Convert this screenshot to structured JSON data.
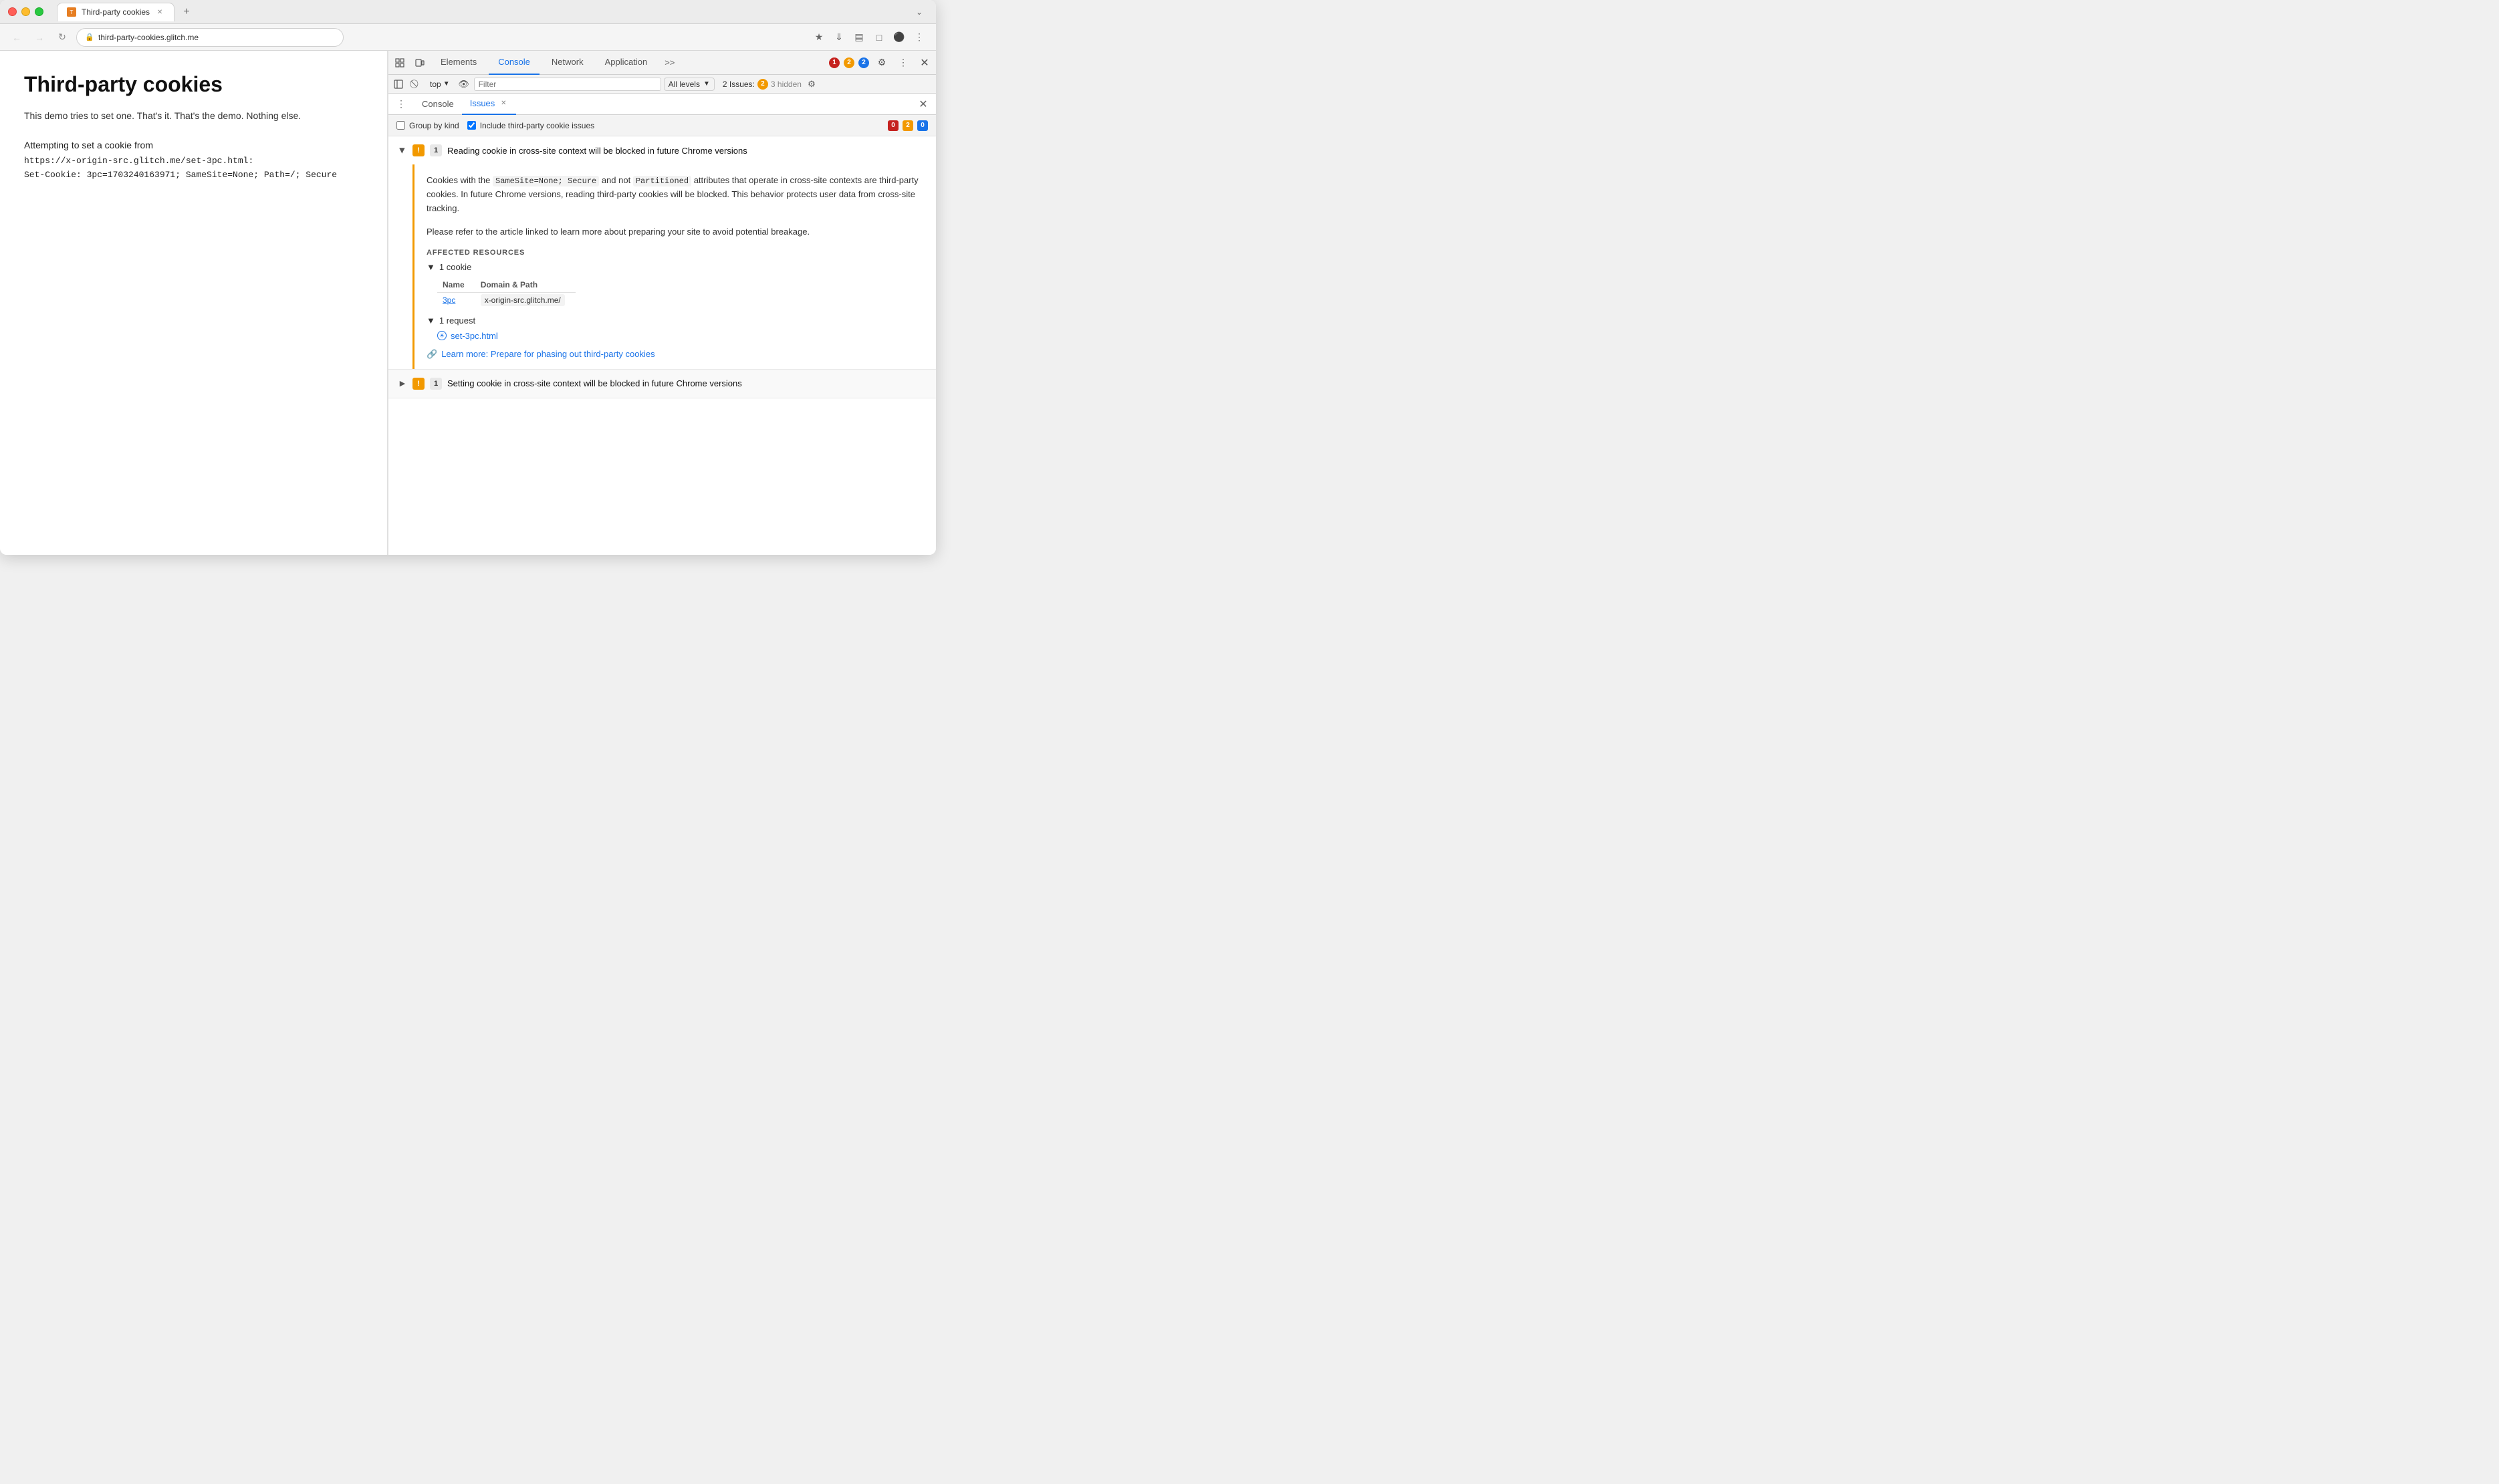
{
  "browser": {
    "title": "Third-party cookies",
    "tab_label": "Third-party cookies",
    "url": "third-party-cookies.glitch.me",
    "favicon": "T"
  },
  "page": {
    "title": "Third-party cookies",
    "description": "This demo tries to set one. That's it. That's the demo. Nothing else.",
    "cookie_label": "Attempting to set a cookie from",
    "cookie_code_line1": "https://x-origin-src.glitch.me/set-3pc.html:",
    "cookie_code_line2": "Set-Cookie: 3pc=1703240163971; SameSite=None; Path=/; Secure"
  },
  "devtools": {
    "tabs": {
      "elements": "Elements",
      "console": "Console",
      "network": "Network",
      "application": "Application",
      "more": ">>"
    },
    "toolbar_badges": {
      "error_count": "1",
      "warning_count": "2",
      "info_count": "2"
    },
    "console_bar": {
      "top_label": "top",
      "filter_placeholder": "Filter",
      "levels_label": "All levels",
      "issues_label": "2 Issues:",
      "issues_count": "2",
      "hidden_label": "3 hidden"
    },
    "inner_tabs": {
      "console_label": "Console",
      "issues_label": "Issues"
    },
    "issues_options": {
      "group_by_kind": "Group by kind",
      "include_third_party": "Include third-party cookie issues",
      "error_count": "0",
      "warning_count": "2",
      "info_count": "0"
    },
    "issue1": {
      "title": "Reading cookie in cross-site context will be blocked in future Chrome versions",
      "count": "1",
      "desc1": "Cookies with the",
      "code1": "SameSite=None; Secure",
      "desc2": "and not",
      "code2": "Partitioned",
      "desc3": "attributes that operate in cross-site contexts are third-party cookies. In future Chrome versions, reading third-party cookies will be blocked. This behavior protects user data from cross-site tracking.",
      "desc4": "Please refer to the article linked to learn more about preparing your site to avoid potential breakage.",
      "affected_resources_label": "AFFECTED RESOURCES",
      "cookie_group_label": "1 cookie",
      "table_col1": "Name",
      "table_col2": "Domain & Path",
      "cookie_name": "3pc",
      "cookie_domain": "x-origin-src.glitch.me/",
      "request_group_label": "1 request",
      "request_link": "set-3pc.html",
      "learn_more_label": "Learn more: Prepare for phasing out third-party cookies"
    },
    "issue2": {
      "title": "Setting cookie in cross-site context will be blocked in future Chrome versions",
      "count": "1",
      "collapsed": true
    }
  }
}
